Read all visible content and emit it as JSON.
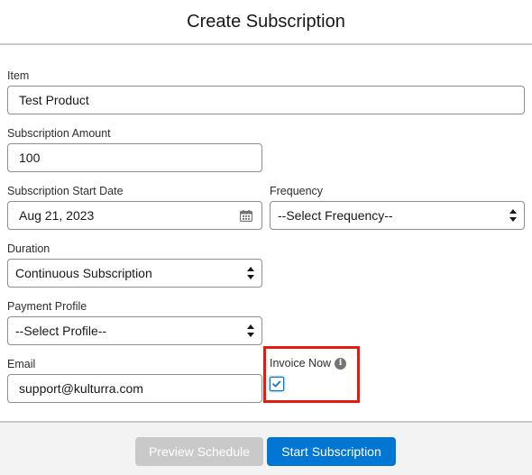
{
  "header": {
    "title": "Create Subscription"
  },
  "form": {
    "item": {
      "label": "Item",
      "value": "Test Product"
    },
    "amount": {
      "label": "Subscription Amount",
      "value": "100"
    },
    "start_date": {
      "label": "Subscription Start Date",
      "value": "Aug 21, 2023",
      "icon": "calendar-icon"
    },
    "frequency": {
      "label": "Frequency",
      "value": "--Select Frequency--"
    },
    "duration": {
      "label": "Duration",
      "value": "Continuous Subscription"
    },
    "payment_profile": {
      "label": "Payment Profile",
      "value": "--Select Profile--"
    },
    "email": {
      "label": "Email",
      "value": "support@kulturra.com"
    },
    "invoice_now": {
      "label": "Invoice Now",
      "info_icon": "i",
      "checked": true
    }
  },
  "footer": {
    "preview_label": "Preview Schedule",
    "start_label": "Start Subscription"
  },
  "colors": {
    "brand": "#0176d3",
    "disabled": "#c9c9c9",
    "highlight": "#e8190f"
  }
}
